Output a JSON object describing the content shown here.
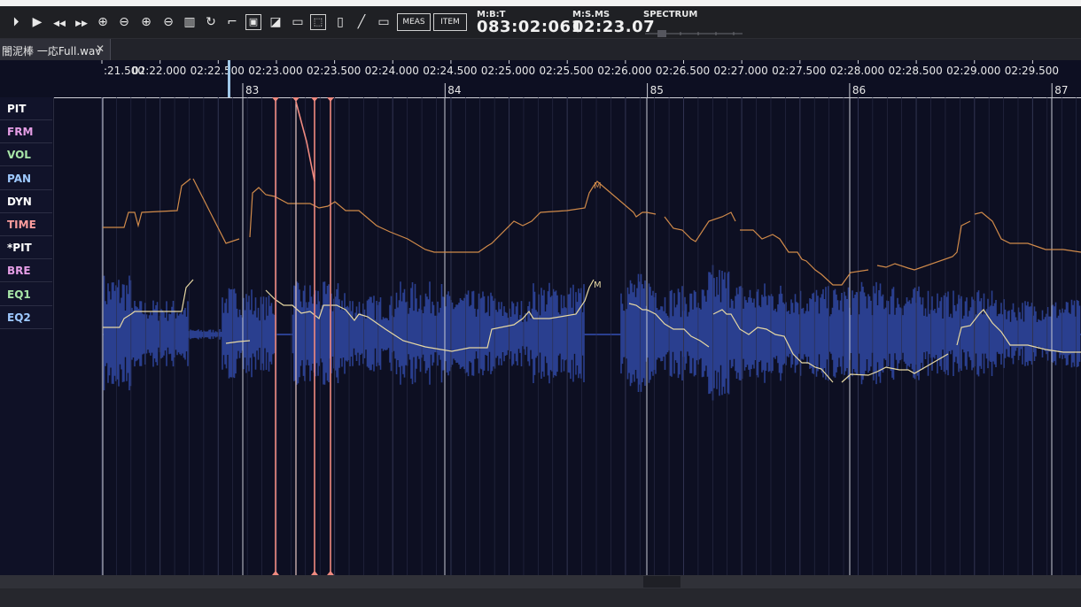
{
  "toolbar": {
    "buttons": [
      {
        "name": "play-from-start-button",
        "glyph": "⏵"
      },
      {
        "name": "play-button",
        "glyph": "▶"
      },
      {
        "name": "rewind-button",
        "glyph": "◀◀"
      },
      {
        "name": "fast-forward-button",
        "glyph": "▶▶"
      },
      {
        "name": "zoom-in-horizontal-button",
        "glyph": "⊕"
      },
      {
        "name": "zoom-out-horizontal-button",
        "glyph": "⊖"
      },
      {
        "name": "zoom-in-vertical-button",
        "glyph": "⊕"
      },
      {
        "name": "zoom-out-vertical-button",
        "glyph": "⊖"
      },
      {
        "name": "view-all-button",
        "glyph": "▥"
      },
      {
        "name": "loop-button",
        "glyph": "↻"
      },
      {
        "name": "step-tool-button",
        "glyph": "⌐"
      },
      {
        "name": "window-tool-button",
        "glyph": "▣"
      },
      {
        "name": "region-tool-button",
        "glyph": "◪"
      },
      {
        "name": "comment-tool-button",
        "glyph": "▭"
      },
      {
        "name": "select-tool-button",
        "glyph": "⬚"
      },
      {
        "name": "eraser-tool-button",
        "glyph": "▯"
      },
      {
        "name": "line-tool-button",
        "glyph": "╱"
      },
      {
        "name": "rectangle-tool-button",
        "glyph": "▭"
      }
    ],
    "meas_label": "MEAS",
    "item_label": "ITEM"
  },
  "readouts": {
    "mbt_label": "M:B:T",
    "mbt_value": "083:02:061",
    "msms_label": "M:S.MS",
    "msms_value": "02:23.07",
    "spectrum_label": "SPECTRUM"
  },
  "tab": {
    "label": "闇泥棒 一応Full.wav",
    "close_glyph": "✕"
  },
  "ruler": {
    "time_labels": [
      ":21.500",
      "02:22.000",
      "02:22.500",
      "02:23.000",
      "02:23.500",
      "02:24.000",
      "02:24.500",
      "02:25.000",
      "02:25.500",
      "02:26.000",
      "02:26.500",
      "02:27.000",
      "02:27.500",
      "02:28.000",
      "02:28.500",
      "02:29.000",
      "02:29.500"
    ],
    "measures": [
      "83",
      "84",
      "85",
      "86",
      "87"
    ]
  },
  "params": [
    {
      "label": "PIT",
      "color": "#ffffff"
    },
    {
      "label": "FRM",
      "color": "#e59ee6"
    },
    {
      "label": "VOL",
      "color": "#a8e6a8"
    },
    {
      "label": "PAN",
      "color": "#9ec9ff"
    },
    {
      "label": "DYN",
      "color": "#ffffff"
    },
    {
      "label": "TIME",
      "color": "#ff9e9e"
    },
    {
      "label": "*PIT",
      "color": "#ffffff"
    },
    {
      "label": "BRE",
      "color": "#e59ee6"
    },
    {
      "label": "EQ1",
      "color": "#a8e6a8"
    },
    {
      "label": "EQ2",
      "color": "#9ec9ff"
    }
  ],
  "plot": {
    "curve_marker": "M",
    "colors": {
      "waveform": "#2a3f8f",
      "upper_curve": "#d08a4a",
      "lower_curve": "#e7d8a3",
      "marker": "#f08a80",
      "playhead": "#9fc7e8",
      "grid": "#2a2d48",
      "measure_line": "#c7c9d4"
    }
  }
}
